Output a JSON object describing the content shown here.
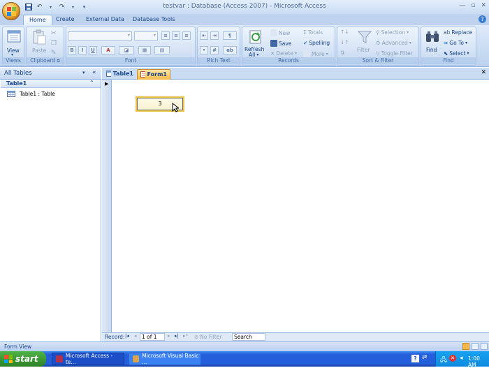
{
  "window": {
    "title": "testvar : Database (Access 2007) - Microsoft Access",
    "controls": [
      "minimize-icon",
      "restore-icon",
      "close-icon"
    ]
  },
  "quick_access": [
    "save-icon",
    "undo-icon",
    "redo-icon",
    "customize-icon"
  ],
  "ribbon_tabs": [
    "Home",
    "Create",
    "External Data",
    "Database Tools"
  ],
  "active_tab": "Home",
  "ribbon": {
    "views": {
      "label": "Views",
      "view_btn": "View"
    },
    "clipboard": {
      "label": "Clipboard",
      "paste_btn": "Paste"
    },
    "font": {
      "label": "Font",
      "bold": "B",
      "italic": "I",
      "underline": "U",
      "font_color": "A"
    },
    "rich_text": {
      "label": "Rich Text"
    },
    "records": {
      "label": "Records",
      "refresh_btn": "Refresh",
      "refresh_sub": "All",
      "new_btn": "New",
      "save_btn": "Save",
      "delete_btn": "Delete",
      "totals_btn": "Totals",
      "spelling_btn": "Spelling",
      "more_btn": "More"
    },
    "sort_filter": {
      "label": "Sort & Filter",
      "filter_btn": "Filter",
      "selection_btn": "Selection",
      "advanced_btn": "Advanced",
      "toggle_filter_btn": "Toggle Filter"
    },
    "find": {
      "label": "Find",
      "find_btn": "Find",
      "replace_btn": "Replace",
      "goto_btn": "Go To",
      "select_btn": "Select"
    }
  },
  "nav_pane": {
    "header": "All Tables",
    "group": "Table1",
    "items": [
      {
        "label": "Table1 : Table"
      }
    ]
  },
  "doc_tabs": [
    {
      "label": "Table1",
      "active": false
    },
    {
      "label": "Form1",
      "active": true
    }
  ],
  "form": {
    "textbox_value": "3"
  },
  "record_nav": {
    "record_label": "Record:",
    "position": "1 of 1",
    "filter_label": "No Filter",
    "search_label": "Search"
  },
  "status_bar": {
    "text": "Form View"
  },
  "taskbar": {
    "start_label": "start",
    "buttons": [
      {
        "label": "Microsoft Access - te..."
      },
      {
        "label": "Microsoft Visual Basic ..."
      }
    ],
    "clock": "1:00 AM"
  },
  "colors": {
    "accent": "#15428b",
    "ribbon": "#c5d9f1",
    "active_tab": "#f5b94a",
    "taskbar": "#245edb",
    "start": "#3c9a35"
  }
}
